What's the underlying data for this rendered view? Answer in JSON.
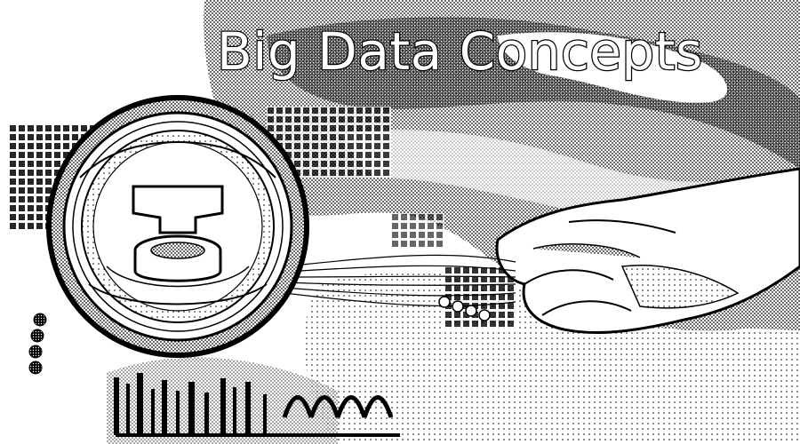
{
  "title": "Big Data Concepts",
  "colors": {
    "ink": "#000000",
    "paper": "#ffffff",
    "halftone": "#7a7a7a"
  },
  "illustration": {
    "subject": "magnifying-glass-over-database-and-hand",
    "style": "monochrome-halftone"
  }
}
